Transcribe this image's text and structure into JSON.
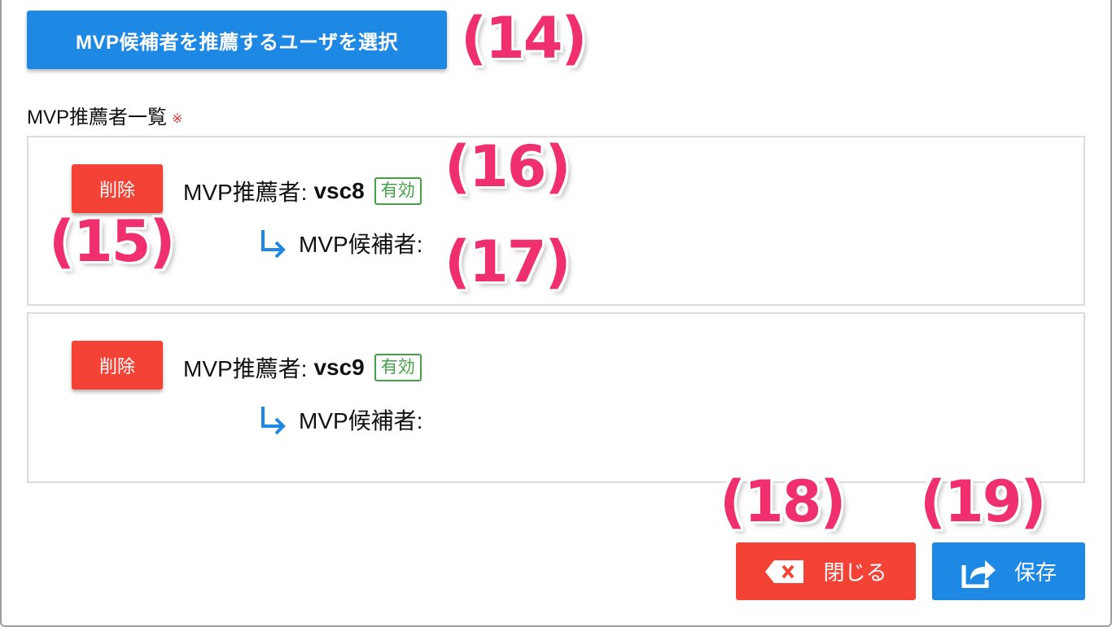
{
  "select_button": {
    "label": "MVP候補者を推薦するユーザを選択"
  },
  "list_label": "MVP推薦者一覧",
  "required_mark": "※",
  "recommenders": [
    {
      "delete_label": "削除",
      "recommender_prefix": "MVP推薦者:",
      "name": "vsc8",
      "status": "有効",
      "candidate_prefix": "MVP候補者:"
    },
    {
      "delete_label": "削除",
      "recommender_prefix": "MVP推薦者:",
      "name": "vsc9",
      "status": "有効",
      "candidate_prefix": "MVP候補者:"
    }
  ],
  "footer": {
    "close_label": "閉じる",
    "save_label": "保存"
  },
  "annotations": [
    "(14)",
    "(15)",
    "(16)",
    "(17)",
    "(18)",
    "(19)"
  ],
  "colors": {
    "primary": "#1e88e5",
    "danger": "#f44336",
    "success": "#43a047",
    "annotation": "#f0306e"
  },
  "icons": {
    "arrow": "subdirectory-arrow-icon",
    "close": "backspace-x-icon",
    "save": "share-export-icon"
  }
}
